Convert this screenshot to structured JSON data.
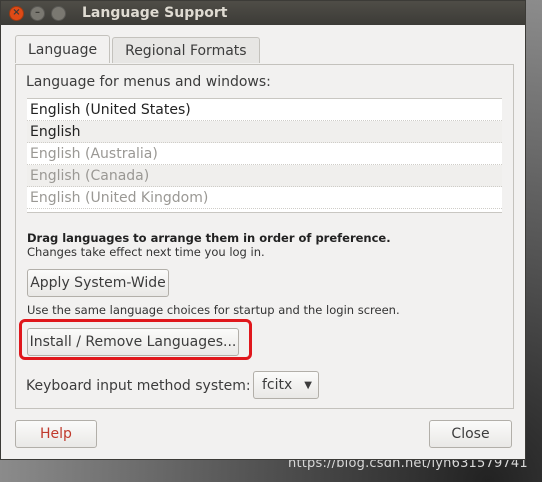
{
  "window": {
    "title": "Language Support",
    "controls": {
      "close": "×",
      "minimize": "–",
      "maximize": ""
    }
  },
  "tabs": [
    {
      "label": "Language",
      "active": true
    },
    {
      "label": "Regional Formats",
      "active": false
    }
  ],
  "language_section": {
    "label": "Language for menus and windows:",
    "languages": [
      {
        "name": "English (United States)",
        "enabled": true
      },
      {
        "name": "English",
        "enabled": true
      },
      {
        "name": "English (Australia)",
        "enabled": false
      },
      {
        "name": "English (Canada)",
        "enabled": false
      },
      {
        "name": "English (United Kingdom)",
        "enabled": false
      }
    ],
    "hint_bold": "Drag languages to arrange them in order of preference.",
    "hint": "Changes take effect next time you log in."
  },
  "buttons": {
    "apply_system_wide": "Apply System-Wide",
    "apply_note": "Use the same language choices for startup and the login screen.",
    "install_remove": "Install / Remove Languages..."
  },
  "keyboard": {
    "label": "Keyboard input method system:",
    "selected": "fcitx",
    "arrow_icon": "▼"
  },
  "footer": {
    "help": "Help",
    "close": "Close"
  },
  "watermark": "https://blog.csdn.net/lyh631579741",
  "colors": {
    "titlebar": "#3c3b37",
    "close_button": "#df4a16",
    "highlight": "#e0171c",
    "help_text": "#c0392b"
  }
}
